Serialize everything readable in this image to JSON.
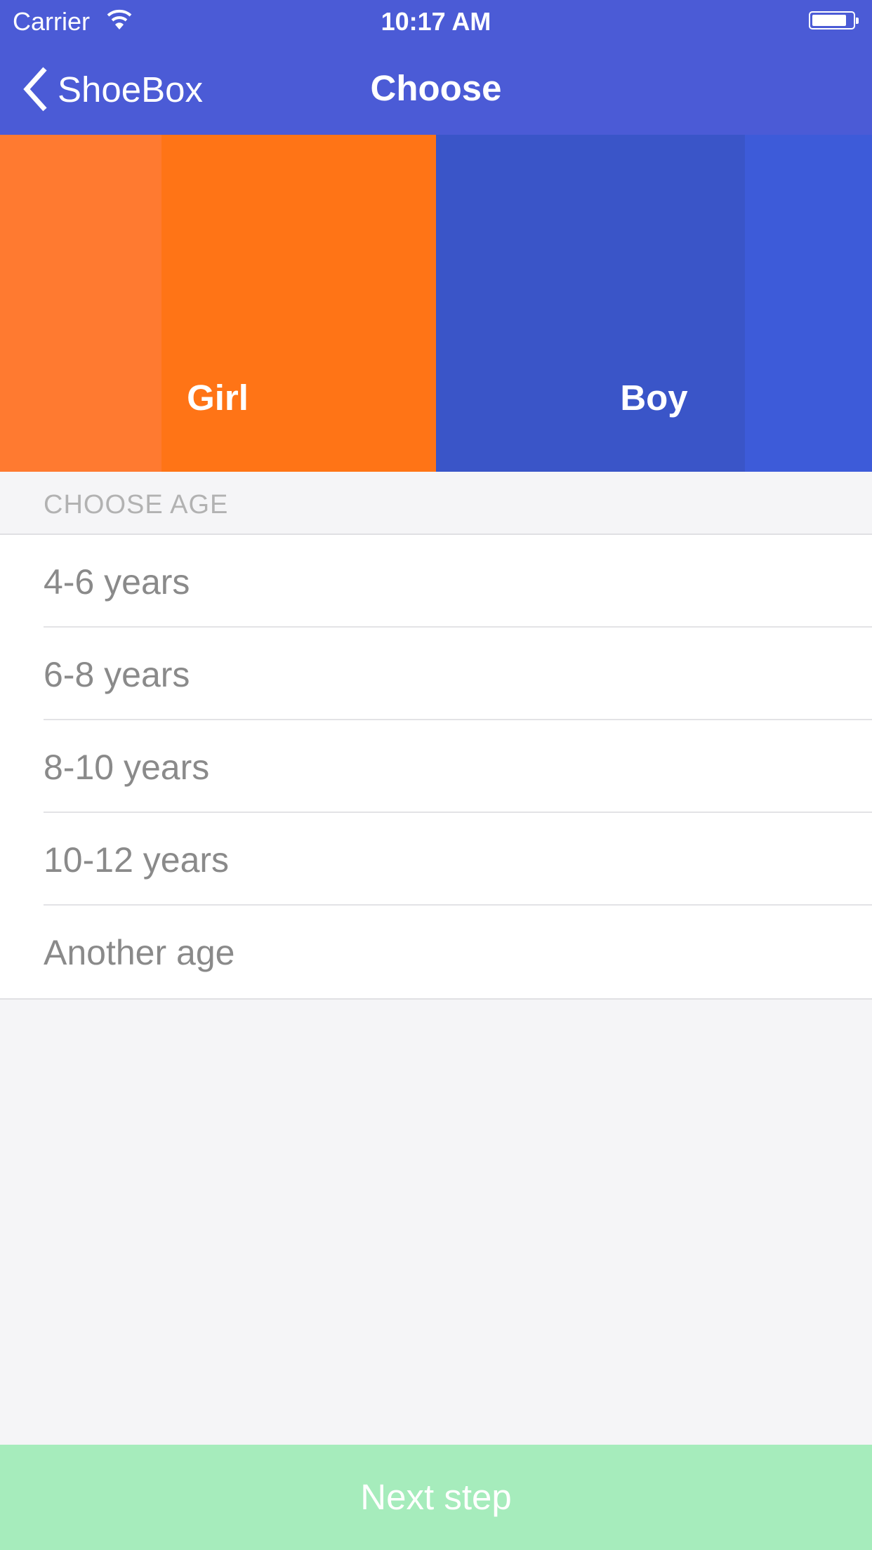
{
  "status_bar": {
    "carrier": "Carrier",
    "time": "10:17 AM",
    "battery_level": 0.85
  },
  "nav": {
    "back_label": "ShoeBox",
    "title": "Choose"
  },
  "hero": {
    "girl": {
      "label": "Girl",
      "color": "#ff7a30"
    },
    "boy": {
      "label": "Boy",
      "color": "#3d5bd9"
    }
  },
  "age_section": {
    "header": "CHOOSE AGE",
    "items": [
      {
        "label": "4-6 years"
      },
      {
        "label": "6-8 years"
      },
      {
        "label": "8-10 years"
      },
      {
        "label": "10-12 years"
      },
      {
        "label": "Another age"
      }
    ]
  },
  "next_button": {
    "label": "Next step",
    "color": "#a6ecbc"
  },
  "colors": {
    "nav": "#4b5bd6"
  }
}
